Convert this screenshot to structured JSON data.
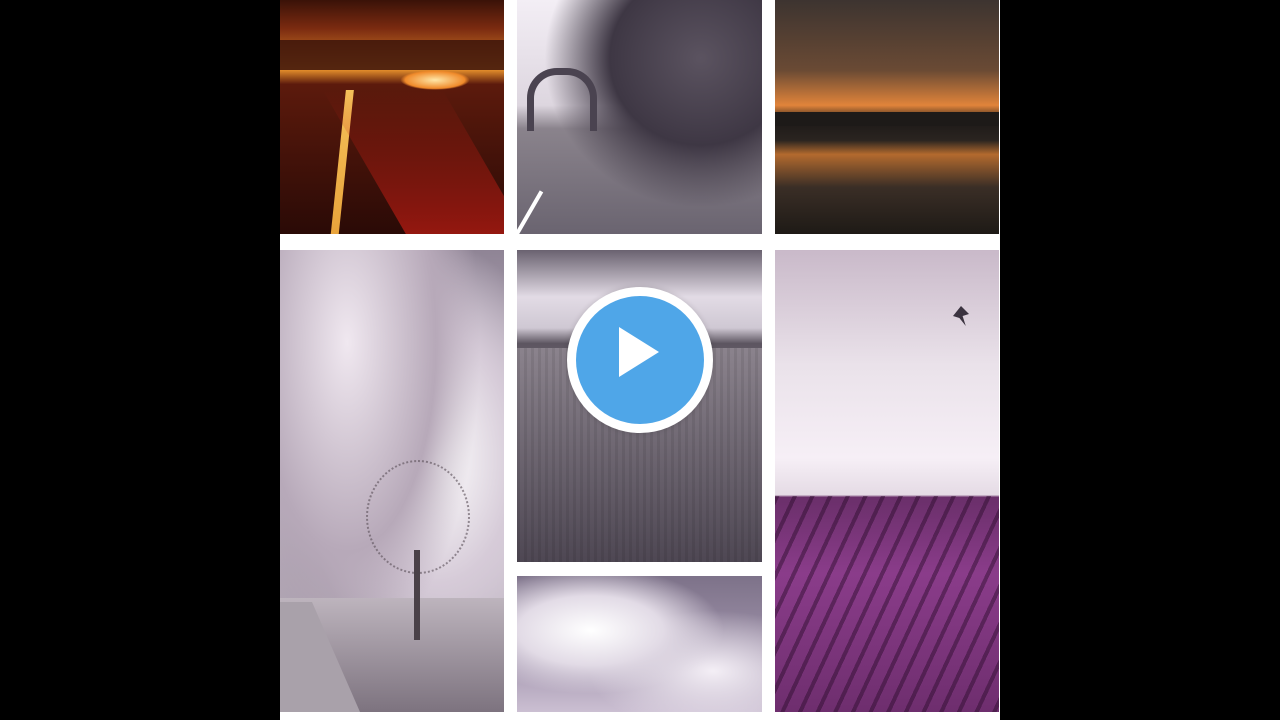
{
  "video": {
    "state": "paused",
    "play_icon": "play-icon",
    "accent_color": "#4fa6e8"
  },
  "collage": {
    "tiles": [
      {
        "id": "road-sunset",
        "dominant_color": "#7a2a10"
      },
      {
        "id": "arch-path",
        "dominant_color": "#ddd6df"
      },
      {
        "id": "water-sunset",
        "dominant_color": "#e1843a"
      },
      {
        "id": "tree-clouds",
        "dominant_color": "#d6cbd8"
      },
      {
        "id": "field",
        "dominant_color": "#7f7781"
      },
      {
        "id": "lavender-field",
        "dominant_color": "#8a3c8a"
      },
      {
        "id": "clouds",
        "dominant_color": "#cbbfd2"
      }
    ]
  }
}
